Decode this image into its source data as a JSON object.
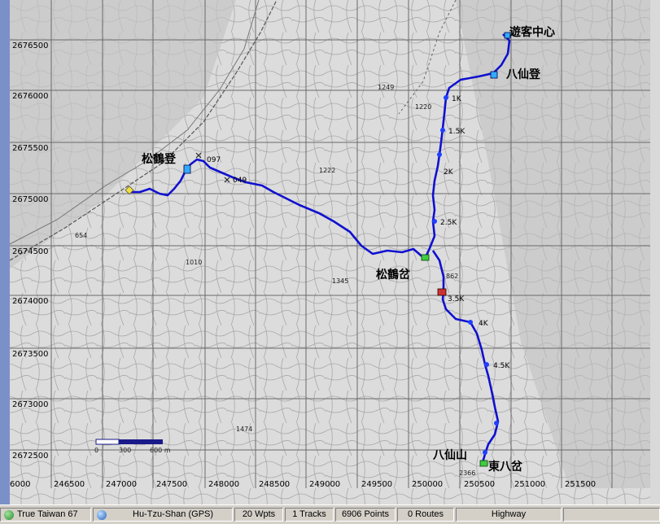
{
  "map": {
    "y_labels": [
      "2676500",
      "2676000",
      "2675500",
      "2675000",
      "2674500",
      "2674000",
      "2673500",
      "2673000",
      "2672500"
    ],
    "x_labels": [
      "6000",
      "246500",
      "247000",
      "247500",
      "248000",
      "248500",
      "249000",
      "249500",
      "250000",
      "250500",
      "251000",
      "251500"
    ],
    "places": {
      "visitor_center": "遊客中心",
      "baxian_trailhead": "八仙登",
      "songhe_trailhead": "松鶴登",
      "songhe_ridge": "松鶴岔",
      "baxian_mountain": "八仙山",
      "east_baxian_fork": "東八岔"
    },
    "waypoints": {
      "k1": "1K",
      "k1_5": "1.5K",
      "k2": "2K",
      "k2_5": "2.5K",
      "k3_5": "3.5K",
      "k4": "4K",
      "k4_5": "4.5K",
      "w097": "097",
      "w049": "049"
    },
    "elevations": [
      "1249",
      "1222",
      "1010",
      "1345",
      "862",
      "1474",
      "2366",
      "654",
      "1220"
    ],
    "scale_bar": {
      "labels": [
        "0",
        "300",
        "600 m"
      ]
    }
  },
  "status_bar": {
    "datum": "True Taiwan 67",
    "map_name": "Hu-Tzu-Shan (GPS)",
    "waypoints": "20 Wpts",
    "tracks": "1 Tracks",
    "points": "6906 Points",
    "routes": "0 Routes",
    "road_type": "Highway"
  },
  "colors": {
    "track": "#1010d0",
    "status_globe": "#2a8a2a",
    "scale_dark": "#1a1a8a"
  }
}
